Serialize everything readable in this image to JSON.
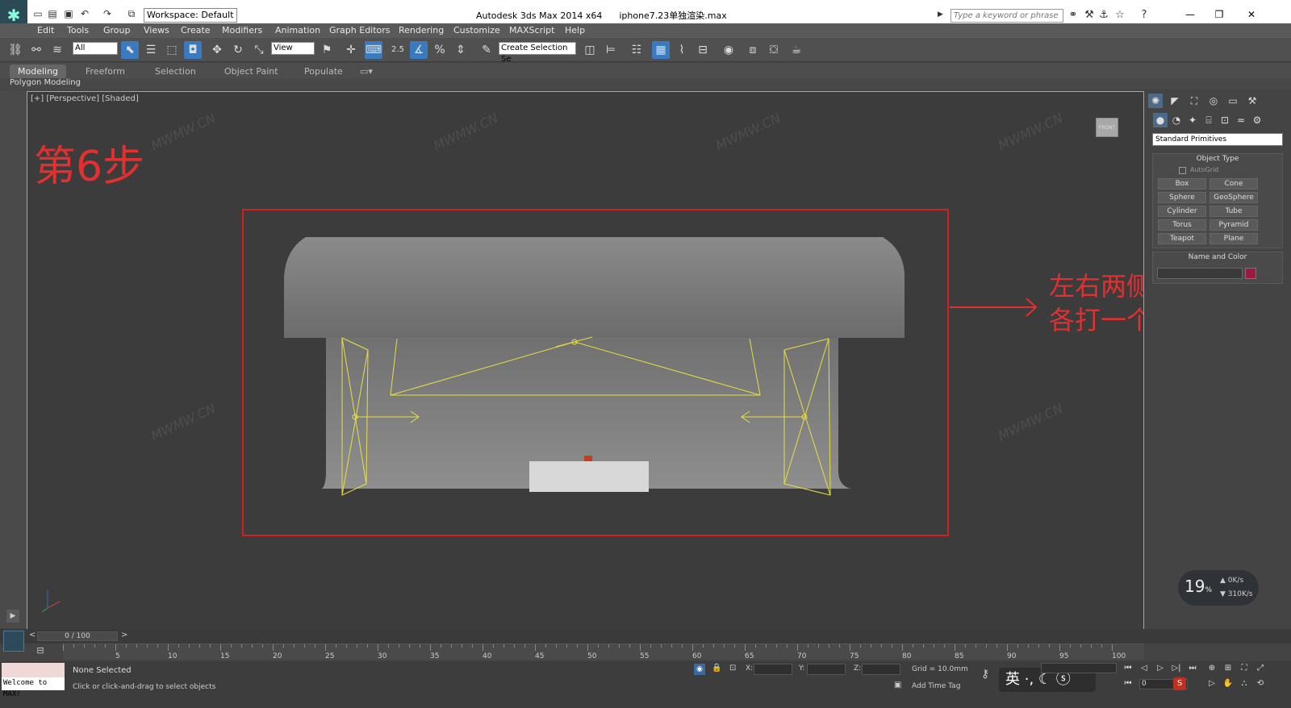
{
  "window": {
    "app_title": "Autodesk 3ds Max  2014 x64",
    "file_name": "iphone7.23单独渲染.max",
    "workspace": "Workspace: Default",
    "search_placeholder": "Type a keyword or phrase"
  },
  "menu": [
    "Edit",
    "Tools",
    "Group",
    "Views",
    "Create",
    "Modifiers",
    "Animation",
    "Graph Editors",
    "Rendering",
    "Customize",
    "MAXScript",
    "Help"
  ],
  "toolbar": {
    "filter_value": "All",
    "ref_coord_value": "View",
    "selection_set_placeholder": "Create Selection Se",
    "snap_label": "2.5"
  },
  "ribbon": {
    "tabs": [
      "Modeling",
      "Freeform",
      "Selection",
      "Object Paint",
      "Populate"
    ],
    "active_tab": "Modeling",
    "sub_panel": "Polygon Modeling"
  },
  "viewport": {
    "label": "[+] [Perspective] [Shaded]",
    "step_text": "第6步",
    "annotation_line1": "左右两侧",
    "annotation_line2": "各打一个VR面光",
    "watermark": "MWMW.CN",
    "viewcube_label": "FRONT"
  },
  "command_panel": {
    "category": "Standard Primitives",
    "object_type_header": "Object Type",
    "autogrid_label": "AutoGrid",
    "buttons": [
      "Box",
      "Cone",
      "Sphere",
      "GeoSphere",
      "Cylinder",
      "Tube",
      "Torus",
      "Pyramid",
      "Teapot",
      "Plane"
    ],
    "name_color_header": "Name and Color",
    "object_color": "#9c1a3e"
  },
  "network_meter": {
    "percent": "19",
    "percent_unit": "%",
    "upload": "0K/s",
    "download": "310K/s"
  },
  "timeline": {
    "frame_display": "0 / 100",
    "ticks": [
      "5",
      "10",
      "15",
      "20",
      "25",
      "30",
      "35",
      "40",
      "45",
      "50",
      "55",
      "60",
      "65",
      "70",
      "75",
      "80",
      "85",
      "90",
      "95",
      "100"
    ]
  },
  "status": {
    "maxscript_welcome": "Welcome to MAX!",
    "selection": "None Selected",
    "prompt": "Click or click-and-drag to select objects",
    "x_label": "X:",
    "y_label": "Y:",
    "z_label": "Z:",
    "grid": "Grid = 10.0mm",
    "add_time_tag": "Add Time Tag",
    "current_frame": "0",
    "ime_text": "英"
  },
  "colors": {
    "annotation_red": "#e03030",
    "light_yellow": "#e8e040",
    "viewport_border": "#c9a640",
    "active_blue": "#3a7bc0"
  }
}
